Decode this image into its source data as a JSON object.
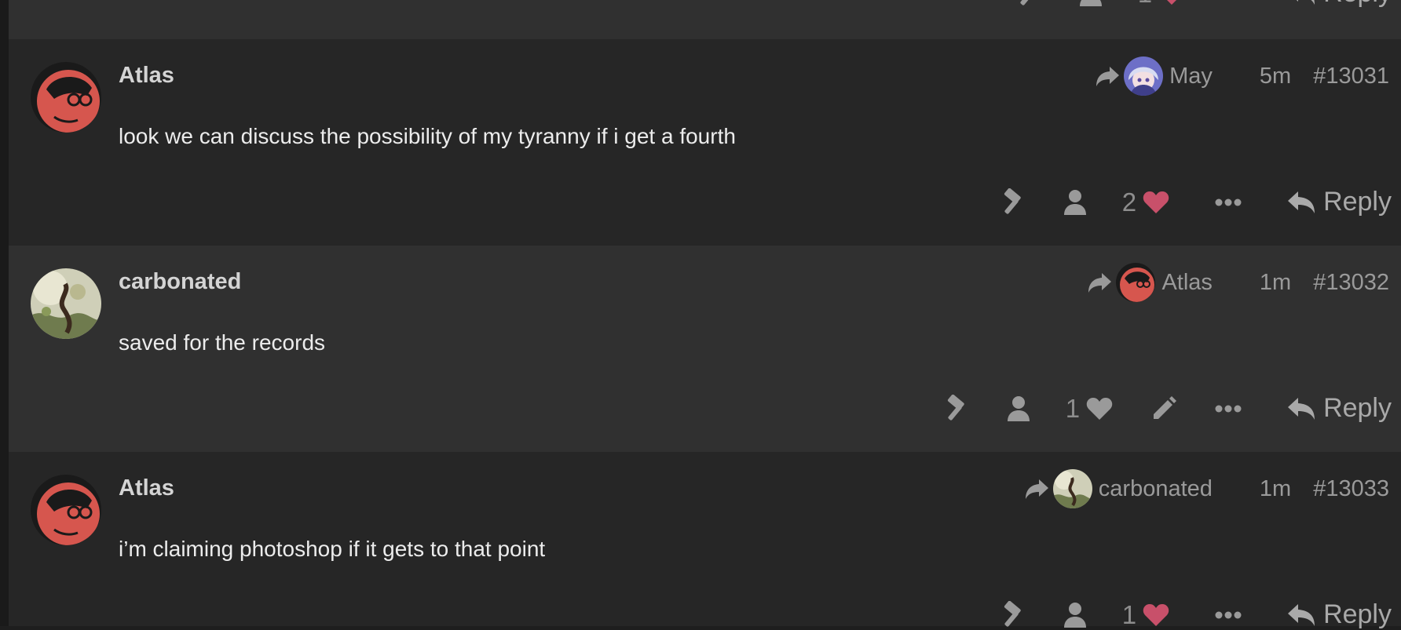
{
  "colors": {
    "like_heart": "#c8506a",
    "icon_gray": "#9a9a9a",
    "avatar_red": "#d6564e"
  },
  "top_partial": {
    "like_count": "1",
    "reply_label": "Reply"
  },
  "posts": [
    {
      "username": "Atlas",
      "body": "look we can discuss the possibility of my tyranny if i get a fourth",
      "reply_to": "May",
      "time": "5m",
      "post_number": "#13031",
      "like_count": "2",
      "reply_label": "Reply",
      "avatar": "red-character-avatar",
      "reply_to_avatar": "anime-girl-avatar"
    },
    {
      "username": "carbonated",
      "body": "saved for the records",
      "reply_to": "Atlas",
      "time": "1m",
      "post_number": "#13032",
      "like_count": "1",
      "reply_label": "Reply",
      "avatar": "nature-art-avatar",
      "reply_to_avatar": "red-character-avatar"
    },
    {
      "username": "Atlas",
      "body": "i’m claiming photoshop if it gets to that point",
      "reply_to": "carbonated",
      "time": "1m",
      "post_number": "#13033",
      "like_count": "1",
      "reply_label": "Reply",
      "avatar": "red-character-avatar",
      "reply_to_avatar": "nature-art-avatar"
    }
  ]
}
